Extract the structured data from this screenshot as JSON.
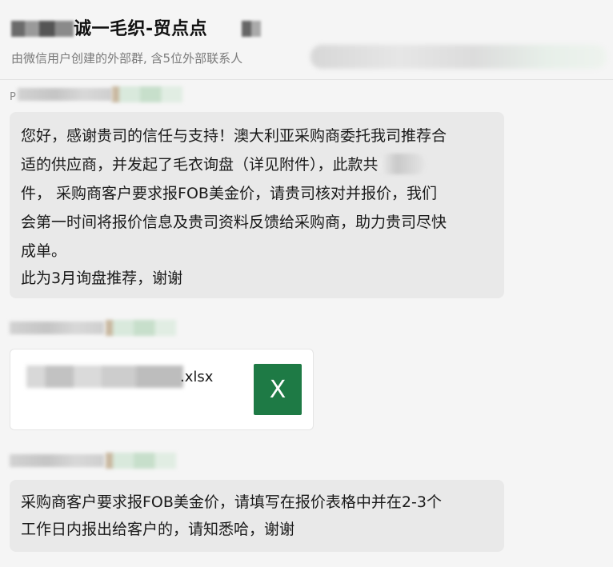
{
  "header": {
    "title": "诚一毛织-贸点点",
    "subtitle": "由微信用户创建的外部群, 含5位外部联系人"
  },
  "messages": [
    {
      "sender_initial": "P",
      "lines": [
        "您好，感谢贵司的信任与支持！澳大利亚采购商委托我司推荐合",
        "适的供应商，并发起了毛衣询盘（详见附件），此款共",
        "件， 采购商客户要求报FOB美金价，请贵司核对并报价，我们",
        "会第一时间将报价信息及贵司资料反馈给采购商，助力贵司尽快",
        "成单。",
        "此为3月询盘推荐，谢谢"
      ]
    },
    {
      "file": {
        "extension": ".xlsx",
        "icon": "excel-icon",
        "icon_letter": "X",
        "icon_color": "#1e7a45"
      }
    },
    {
      "lines": [
        "采购商客户要求报FOB美金价，请填写在报价表格中并在2-3个",
        "工作日内报出给客户的，请知悉哈，谢谢"
      ]
    }
  ]
}
